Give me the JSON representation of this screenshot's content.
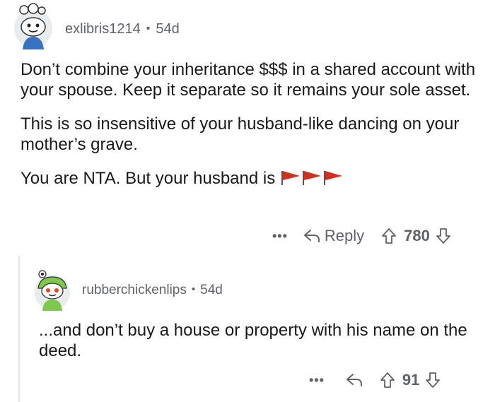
{
  "comment": {
    "username": "exlibris1214",
    "separator": "•",
    "age": "54d",
    "paragraphs": [
      "Don’t combine your inheritance $$$ in a shared account with your spouse. Keep it separate so it remains your sole asset.",
      "This is so insensitive of your husband-like dancing on your mother’s grave.",
      "You are NTA.  But your husband is"
    ],
    "trailing_icons": [
      "red-flag-icon",
      "red-flag-icon",
      "red-flag-icon"
    ],
    "actions": {
      "more": "•••",
      "reply_label": "Reply",
      "vote_count": "780"
    }
  },
  "reply": {
    "username": "rubberchickenlips",
    "separator": "•",
    "age": "54d",
    "text": "...and don’t buy a house or property with his name on the deed.",
    "actions": {
      "more": "•••",
      "vote_count": "91"
    }
  },
  "colors": {
    "text": "#1a1a1b",
    "meta": "#5f6368",
    "flag": "#d32f1e",
    "thread_line": "#e5e5e5"
  }
}
